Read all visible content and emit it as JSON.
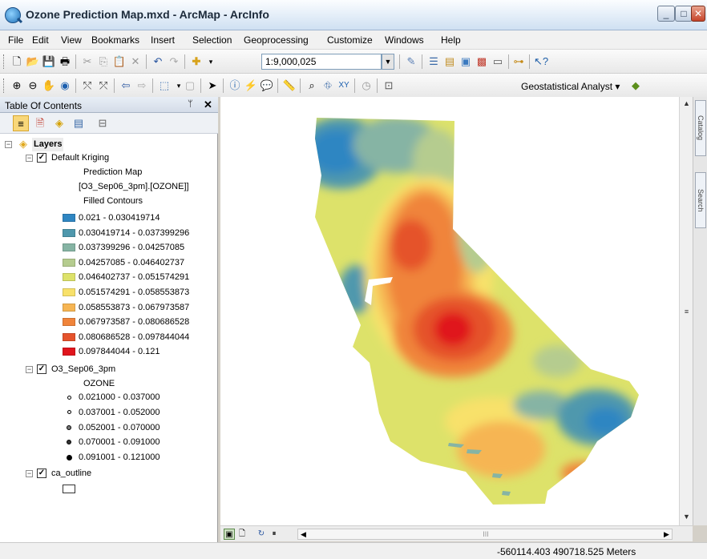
{
  "window": {
    "title": "Ozone Prediction Map.mxd - ArcMap - ArcInfo",
    "min": "_",
    "max": "□",
    "close": "✕"
  },
  "menu": [
    "File",
    "Edit",
    "View",
    "Bookmarks",
    "Insert",
    "Selection",
    "Geoprocessing",
    "Customize",
    "Windows",
    "Help"
  ],
  "toolbar": {
    "scale": "1:9,000,025",
    "geostat_label": "Geostatistical Analyst ▾"
  },
  "toc": {
    "title": "Table Of Contents",
    "pin": "ᛘ",
    "close": "✕",
    "root_label": "Layers",
    "kriging": {
      "name": "Default Kriging",
      "subtitle1": "Prediction Map",
      "subtitle2": "[O3_Sep06_3pm].[OZONE]]",
      "subtitle3": "Filled Contours",
      "classes": [
        {
          "label": "0.021 - 0.030419714",
          "color": "#2f86c2"
        },
        {
          "label": "0.030419714 - 0.037399296",
          "color": "#4f98ad"
        },
        {
          "label": "0.037399296 - 0.04257085",
          "color": "#86b4a4"
        },
        {
          "label": "0.04257085 - 0.046402737",
          "color": "#b5cc8f"
        },
        {
          "label": "0.046402737 - 0.051574291",
          "color": "#dde26a"
        },
        {
          "label": "0.051574291 - 0.058553873",
          "color": "#f8e16a"
        },
        {
          "label": "0.058553873 - 0.067973587",
          "color": "#f6b553"
        },
        {
          "label": "0.067973587 - 0.080686528",
          "color": "#f0843a"
        },
        {
          "label": "0.080686528 - 0.097844044",
          "color": "#e5532c"
        },
        {
          "label": "0.097844044 - 0.121",
          "color": "#e0141c"
        }
      ]
    },
    "points": {
      "name": "O3_Sep06_3pm",
      "field": "OZONE",
      "classes": [
        "0.021000 - 0.037000",
        "0.037001 - 0.052000",
        "0.052001 - 0.070000",
        "0.070001 - 0.091000",
        "0.091001 - 0.121000"
      ]
    },
    "outline": {
      "name": "ca_outline"
    }
  },
  "side_tabs": [
    "Catalog",
    "Search"
  ],
  "scroll_label": "III",
  "status": {
    "coords": "-560114.403  490718.525 Meters"
  }
}
